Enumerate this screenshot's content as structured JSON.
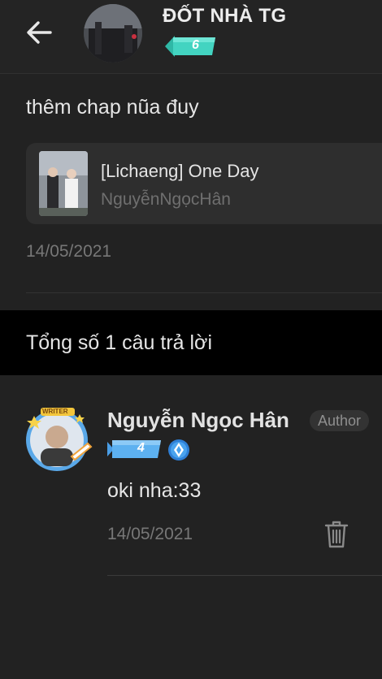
{
  "header": {
    "back_icon": "arrow-left-icon",
    "title": "ĐỐT NHÀ TG",
    "level": "6",
    "level_color": "#3ecfc0"
  },
  "post": {
    "comment": "thêm chap nũa đuy",
    "story": {
      "title": "[Lichaeng] One Day",
      "author": "NguyễnNgọcHân"
    },
    "date": "14/05/2021"
  },
  "replies": {
    "total_label": "Tổng số 1 câu trả lời",
    "items": [
      {
        "name": "Nguyễn Ngọc Hân",
        "tag": "Author",
        "level": "4",
        "level_color": "#4aa3e8",
        "frame_label": "WRITER",
        "text": "oki nha:33",
        "date": "14/05/2021",
        "delete_icon": "trash-icon"
      }
    ]
  }
}
